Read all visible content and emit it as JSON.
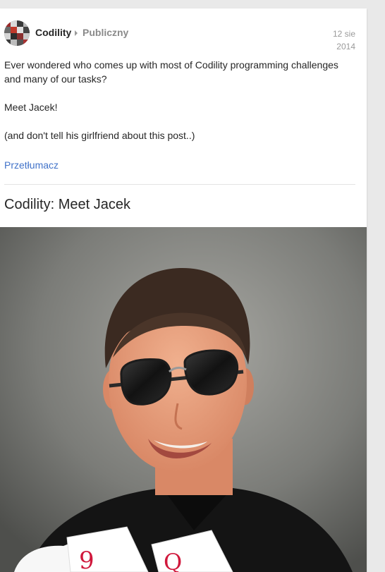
{
  "post": {
    "author": "Codility",
    "visibility": "Publiczny",
    "date_line1": "12 sie",
    "date_line2": "2014",
    "paragraphs": [
      "Ever wondered who comes up with most of Codility programming challenges and many of our tasks?",
      "Meet Jacek!",
      "(and don't tell his girlfriend about this post..)"
    ],
    "translate_label": "Przetłumacz",
    "link_title": "Codility: Meet Jacek"
  },
  "colors": {
    "link": "#4273c9",
    "text": "#262626",
    "muted": "#8a8a8a"
  },
  "icons": {
    "visibility_arrow": "caret-right-icon"
  }
}
